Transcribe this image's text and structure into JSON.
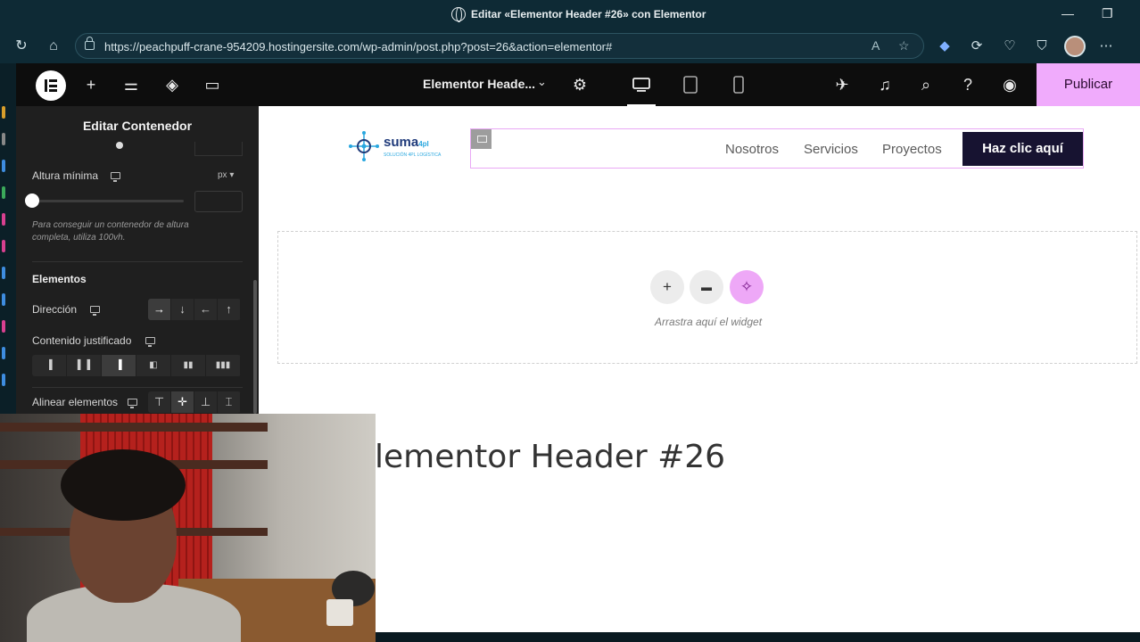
{
  "browser": {
    "tab_title": "Editar «Elementor Header #26» con Elementor",
    "url": "https://peachpuff-crane-954209.hostingersite.com/wp-admin/post.php?post=26&action=elementor#",
    "url_icons": [
      "read-aloud-icon",
      "favorite-star-icon"
    ],
    "toolbar_icons": [
      "extension-icon",
      "refresh-extension-icon",
      "heart-pulse-icon",
      "shield-icon",
      "profile-avatar",
      "more-icon"
    ]
  },
  "elementor": {
    "document_name": "Elementor Heade...",
    "publish_label": "Publicar",
    "top_icons": [
      "add-icon",
      "sliders-icon",
      "layers-icon",
      "comments-icon"
    ],
    "right_icons": [
      "rocket-icon",
      "notifications-icon",
      "search-icon",
      "help-icon",
      "preview-eye-icon"
    ],
    "devices": [
      "desktop",
      "tablet",
      "mobile"
    ],
    "active_device": "desktop"
  },
  "panel": {
    "title": "Editar Contenedor",
    "min_height_label": "Altura mínima",
    "min_height_unit": "px",
    "min_height_value": "",
    "help_text": "Para conseguir un contenedor de altura completa, utiliza 100vh.",
    "section_title": "Elementos",
    "direction_label": "Dirección",
    "direction_options": [
      "→",
      "↓",
      "←",
      "↑"
    ],
    "direction_selected": 0,
    "justify_label": "Contenido justificado",
    "justify_options": [
      "▐",
      "▌▐",
      "▐",
      "◧",
      "▮▮",
      "▮▮▮"
    ],
    "justify_selected": 2,
    "align_label": "Alinear elementos",
    "align_options": [
      "⊤",
      "✛",
      "⊥",
      "⌶"
    ],
    "align_selected": 1
  },
  "canvas": {
    "logo_text": "suma",
    "logo_suffix": "4pl",
    "logo_tagline": "SOLUCIÓN 4PL LOGÍSTICA",
    "nav": [
      "Nosotros",
      "Servicios",
      "Proyectos"
    ],
    "cta_label": "Haz clic aquí",
    "dropzone_text": "Arrastra aquí el widget",
    "dropzone_buttons": [
      "+",
      "▬",
      "✧"
    ],
    "page_title": "lementor Header #26"
  },
  "colors": {
    "publish_bg": "#f0abfc",
    "cta_bg": "#171331",
    "selection_border": "#e9a8f5",
    "browser_chrome": "#0e2a35"
  }
}
